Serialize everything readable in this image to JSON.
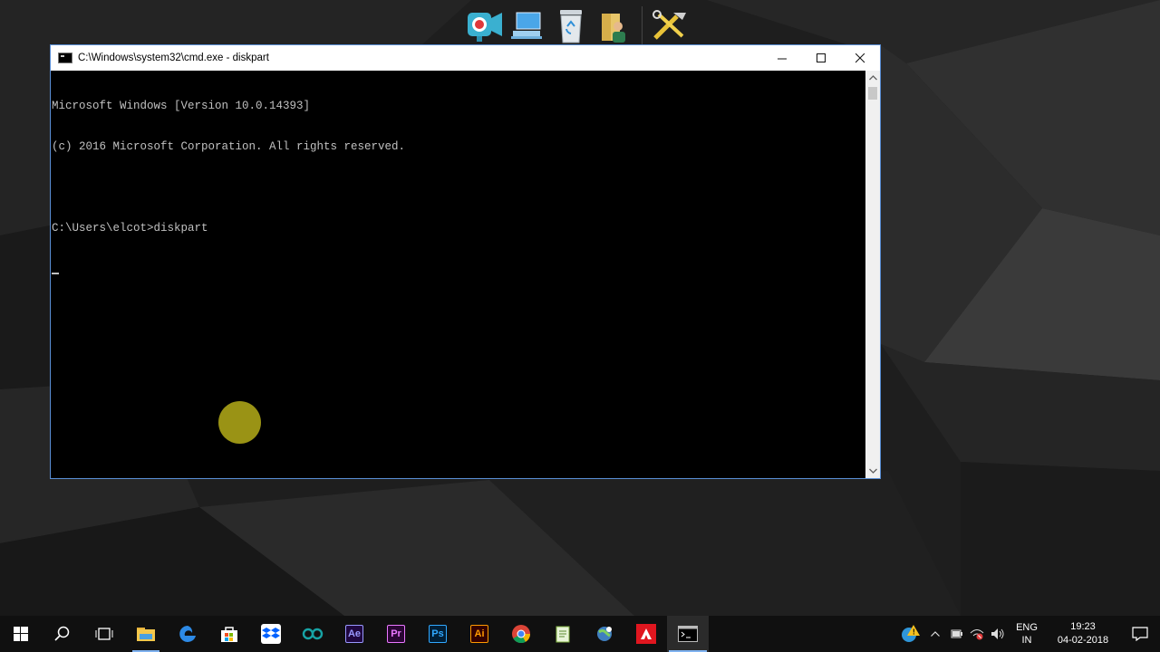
{
  "window": {
    "title": "C:\\Windows\\system32\\cmd.exe - diskpart",
    "controls": {
      "minimize": "—",
      "maximize": "☐",
      "close": "✕"
    }
  },
  "console": {
    "lines": [
      "Microsoft Windows [Version 10.0.14393]",
      "(c) 2016 Microsoft Corporation. All rights reserved.",
      "",
      "C:\\Users\\elcot>diskpart"
    ]
  },
  "desktop_icons": [
    "screen-recorder-icon",
    "this-pc-icon",
    "recycle-bin-icon",
    "user-folder-icon",
    "tools-icon"
  ],
  "taskbar": {
    "apps": [
      {
        "name": "start-button",
        "icon": "windows-logo-icon"
      },
      {
        "name": "search-button",
        "icon": "search-icon"
      },
      {
        "name": "task-view-button",
        "icon": "task-view-icon"
      },
      {
        "name": "file-explorer-button",
        "icon": "folder-icon"
      },
      {
        "name": "edge-button",
        "icon": "edge-icon"
      },
      {
        "name": "store-button",
        "icon": "store-icon"
      },
      {
        "name": "dropbox-button",
        "icon": "dropbox-icon"
      },
      {
        "name": "arduino-button",
        "icon": "arduino-icon"
      },
      {
        "name": "after-effects-button",
        "label": "Ae",
        "color": "#9999ff",
        "bg": "#1f0740"
      },
      {
        "name": "premiere-button",
        "label": "Pr",
        "color": "#ea77ff",
        "bg": "#2a0634"
      },
      {
        "name": "photoshop-button",
        "label": "Ps",
        "color": "#31a8ff",
        "bg": "#001e36"
      },
      {
        "name": "illustrator-button",
        "label": "Ai",
        "color": "#ff9a00",
        "bg": "#330000"
      },
      {
        "name": "chrome-button",
        "icon": "chrome-icon"
      },
      {
        "name": "notepad-button",
        "icon": "notepad-icon"
      },
      {
        "name": "network-tool-button",
        "icon": "globe-icon"
      },
      {
        "name": "amd-button",
        "icon": "amd-icon"
      },
      {
        "name": "cmd-button",
        "icon": "cmd-icon"
      }
    ],
    "tray": {
      "language_line1": "ENG",
      "language_line2": "IN",
      "time": "19:23",
      "date": "04-02-2018"
    }
  },
  "colors": {
    "console_bg": "#000000",
    "console_text": "#c0c0c0",
    "window_border": "#5a8fd6",
    "taskbar_bg": "#101010",
    "accent": "#7fb2f0"
  }
}
